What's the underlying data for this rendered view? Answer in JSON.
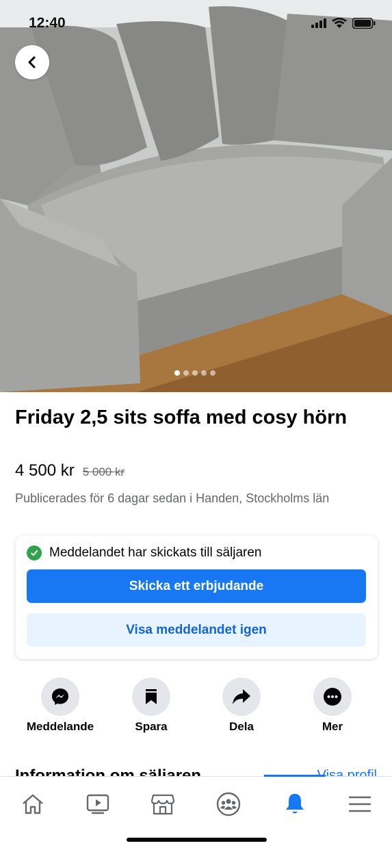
{
  "status_bar": {
    "time": "12:40"
  },
  "listing": {
    "title": "Friday 2,5 sits soffa med cosy hörn",
    "price": "4 500 kr",
    "original_price": "5 000 kr",
    "posted": "Publicerades för 6 dagar sedan i Handen, Stockholms län",
    "photo_count": 5,
    "current_photo": 1
  },
  "message_card": {
    "status_text": "Meddelandet har skickats till säljaren",
    "primary_button": "Skicka ett erbjudande",
    "secondary_button": "Visa meddelandet igen"
  },
  "actions": [
    {
      "label": "Meddelande",
      "icon": "messenger-icon"
    },
    {
      "label": "Spara",
      "icon": "bookmark-icon"
    },
    {
      "label": "Dela",
      "icon": "share-icon"
    },
    {
      "label": "Mer",
      "icon": "more-icon"
    }
  ],
  "seller_section": {
    "title": "Information om säljaren",
    "link": "Visa profil"
  },
  "tabbar": {
    "tabs": [
      {
        "icon": "home-icon"
      },
      {
        "icon": "watch-icon"
      },
      {
        "icon": "marketplace-icon"
      },
      {
        "icon": "groups-icon"
      },
      {
        "icon": "notifications-icon",
        "active": true
      },
      {
        "icon": "menu-icon"
      }
    ]
  },
  "colors": {
    "accent": "#1877f2",
    "success": "#31a24c",
    "secondary_button_bg": "#e7f3ff"
  }
}
